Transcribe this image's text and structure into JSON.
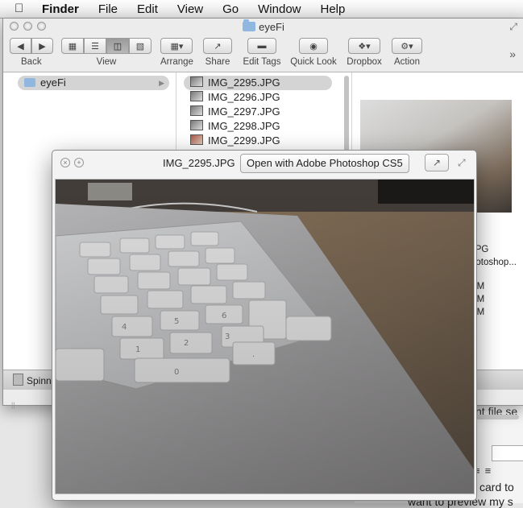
{
  "menubar": {
    "items": [
      "Finder",
      "File",
      "Edit",
      "View",
      "Go",
      "Window",
      "Help"
    ]
  },
  "finder": {
    "title": "eyeFi",
    "toolbar": {
      "back": "Back",
      "view": "View",
      "arrange": "Arrange",
      "share": "Share",
      "edit_tags": "Edit Tags",
      "quick_look": "Quick Look",
      "dropbox": "Dropbox",
      "action": "Action"
    },
    "sidebar_folder": "eyeFi",
    "files": [
      "IMG_2295.JPG",
      "IMG_2296.JPG",
      "IMG_2297.JPG",
      "IMG_2298.JPG",
      "IMG_2299.JPG"
    ],
    "selected_file": "IMG_2295.JPG",
    "preview_info": [
      "JPG",
      "hotoshop...",
      "PM",
      "PM",
      "PM"
    ],
    "status_disk": "Spinn"
  },
  "quicklook": {
    "title": "IMG_2295.JPG",
    "open_with": "Open with Adobe Photoshop CS5"
  },
  "background_doc": {
    "text1": "nt file se",
    "text2": "card to",
    "text3": "want to preview my s"
  },
  "photo_keys": [
    "0",
    "1",
    "2",
    "3",
    "4",
    "5",
    "6",
    "."
  ],
  "colors": {
    "selection": "#d4d4d4",
    "window_bg": "#ececec",
    "desk_wood": "#8a7358"
  }
}
